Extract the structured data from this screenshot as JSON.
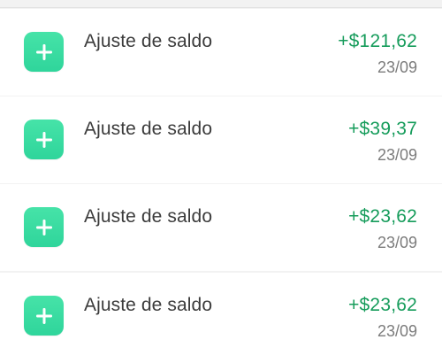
{
  "transactions": [
    {
      "label": "Ajuste de saldo",
      "amount": "+$121,62",
      "date": "23/09",
      "icon": "plus-icon"
    },
    {
      "label": "Ajuste de saldo",
      "amount": "+$39,37",
      "date": "23/09",
      "icon": "plus-icon"
    },
    {
      "label": "Ajuste de saldo",
      "amount": "+$23,62",
      "date": "23/09",
      "icon": "plus-icon"
    },
    {
      "label": "Ajuste de saldo",
      "amount": "+$23,62",
      "date": "23/09",
      "icon": "plus-icon"
    }
  ],
  "colors": {
    "accent_green": "#169c5b",
    "icon_green": "#3ddca2",
    "text_primary": "#3b3b3b",
    "text_secondary": "#7c7c7c",
    "background": "#f2f2f2"
  }
}
